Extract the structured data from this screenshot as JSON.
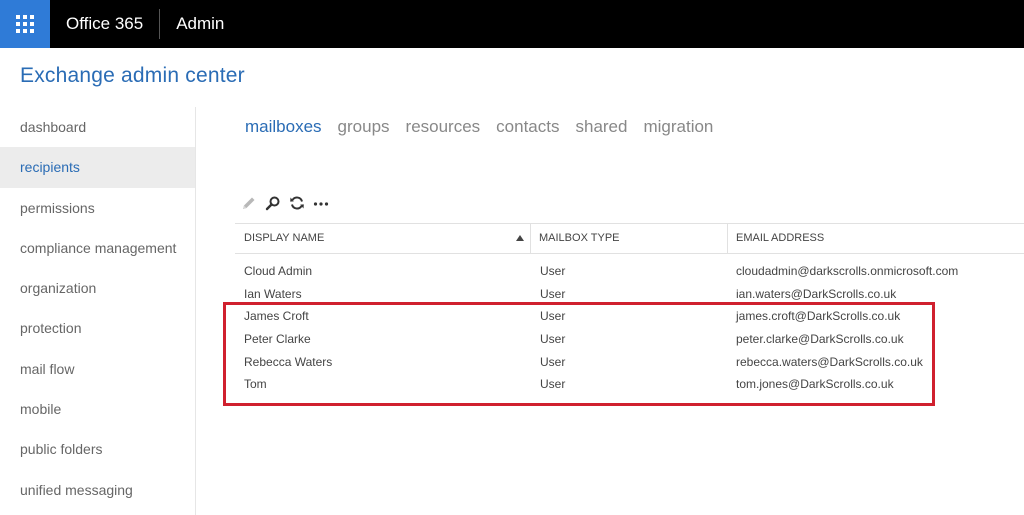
{
  "topbar": {
    "brand": "Office 365",
    "app_name": "Admin"
  },
  "header": {
    "title": "Exchange admin center"
  },
  "nav": {
    "items": [
      {
        "label": "dashboard",
        "active": false
      },
      {
        "label": "recipients",
        "active": true
      },
      {
        "label": "permissions",
        "active": false
      },
      {
        "label": "compliance management",
        "active": false
      },
      {
        "label": "organization",
        "active": false
      },
      {
        "label": "protection",
        "active": false
      },
      {
        "label": "mail flow",
        "active": false
      },
      {
        "label": "mobile",
        "active": false
      },
      {
        "label": "public folders",
        "active": false
      },
      {
        "label": "unified messaging",
        "active": false
      }
    ]
  },
  "tabs": [
    {
      "label": "mailboxes",
      "active": true
    },
    {
      "label": "groups",
      "active": false
    },
    {
      "label": "resources",
      "active": false
    },
    {
      "label": "contacts",
      "active": false
    },
    {
      "label": "shared",
      "active": false
    },
    {
      "label": "migration",
      "active": false
    }
  ],
  "toolbar": {
    "icons": [
      "pencil-icon",
      "search-icon",
      "refresh-icon",
      "more-icon"
    ]
  },
  "table": {
    "columns": [
      "DISPLAY NAME",
      "MAILBOX TYPE",
      "EMAIL ADDRESS"
    ],
    "sorted_column": "DISPLAY NAME",
    "rows": [
      {
        "name": "Cloud Admin",
        "type": "User",
        "email": "cloudadmin@darkscrolls.onmicrosoft.com"
      },
      {
        "name": "Ian Waters",
        "type": "User",
        "email": "ian.waters@DarkScrolls.co.uk"
      },
      {
        "name": "James Croft",
        "type": "User",
        "email": "james.croft@DarkScrolls.co.uk"
      },
      {
        "name": "Peter Clarke",
        "type": "User",
        "email": "peter.clarke@DarkScrolls.co.uk"
      },
      {
        "name": "Rebecca Waters",
        "type": "User",
        "email": "rebecca.waters@DarkScrolls.co.uk"
      },
      {
        "name": "Tom",
        "type": "User",
        "email": "tom.jones@DarkScrolls.co.uk"
      }
    ]
  },
  "colors": {
    "accent": "#2a6cb5",
    "topbar": "#000000",
    "waffle": "#2f7bd7",
    "highlight": "#d0202e"
  }
}
